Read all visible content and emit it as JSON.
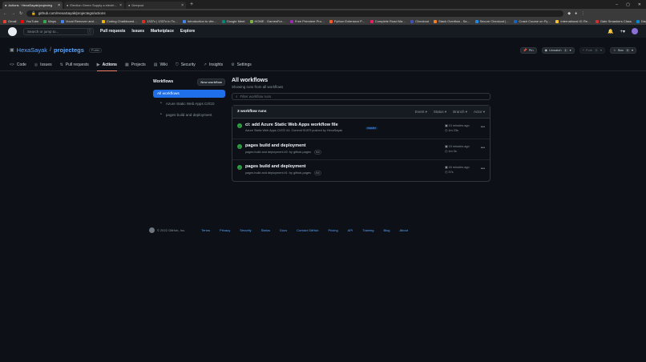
{
  "browser": {
    "tabs": [
      {
        "title": "Actions · HexaSayak/projecteg",
        "active": true
      },
      {
        "title": "Election Green Supply a electri…",
        "active": false
      },
      {
        "title": "Deepcut",
        "active": false
      }
    ],
    "url": "github.com/HexaSayak/projectegs/actions",
    "bookmarks": [
      {
        "label": "Gmail",
        "color": "#ea4335"
      },
      {
        "label": "YouTube",
        "color": "#ff0000"
      },
      {
        "label": "Maps",
        "color": "#34a853"
      },
      {
        "label": "Vocal Remover and…",
        "color": "#4285f4"
      },
      {
        "label": "Coding Chalkboard…",
        "color": "#f4b400"
      },
      {
        "label": "1337x | 1337x.to To…",
        "color": "#d93025"
      },
      {
        "label": "Introduction to vite…",
        "color": "#4285f4"
      },
      {
        "label": "Google Meet",
        "color": "#00897b"
      },
      {
        "label": "HOME - GamesFor…",
        "color": "#7cb342"
      },
      {
        "label": "Free Premiere Pro…",
        "color": "#9c27b0"
      },
      {
        "label": "Python Extension P…",
        "color": "#ff5722"
      },
      {
        "label": "Complete Road Ma…",
        "color": "#e91e63"
      },
      {
        "label": "Checkout",
        "color": "#3f51b5"
      },
      {
        "label": "Stack Overflow - Sa…",
        "color": "#f48024"
      },
      {
        "label": "Secure Checkout |…",
        "color": "#1e88e5"
      },
      {
        "label": "Crash Course on Py…",
        "color": "#1565c0"
      },
      {
        "label": "International IG Re…",
        "color": "#fbc02d"
      },
      {
        "label": "Gate Smashers Class",
        "color": "#d32f2f"
      },
      {
        "label": "Discussion Form",
        "color": "#0288d1"
      }
    ]
  },
  "github": {
    "search_placeholder": "Search or jump to...",
    "search_key": "/",
    "nav": [
      "Pull requests",
      "Issues",
      "Marketplace",
      "Explore"
    ]
  },
  "repo": {
    "owner": "HexaSayak",
    "name": "projectegs",
    "visibility": "Public",
    "pin_label": "Pin",
    "watch_label": "Unwatch",
    "watch_count": "1",
    "fork_label": "Fork",
    "fork_count": "0",
    "star_label": "Star",
    "star_count": "0",
    "tabs": [
      "Code",
      "Issues",
      "Pull requests",
      "Actions",
      "Projects",
      "Wiki",
      "Security",
      "Insights",
      "Settings"
    ]
  },
  "sidebar": {
    "title": "Workflows",
    "new_button": "New workflow",
    "all_label": "All workflows",
    "items": [
      "Azure Static Web Apps CI/CD",
      "pages build and deployment"
    ]
  },
  "content": {
    "title": "All workflows",
    "subtitle": "Showing runs from all workflows",
    "filter_placeholder": "Filter workflow runs",
    "runs_count": "3 workflow runs",
    "filters": [
      "Event",
      "Status",
      "Branch",
      "Actor"
    ],
    "runs": [
      {
        "title": "ci: add Azure Static Web Apps workflow file",
        "meta": "Azure Static Web Apps CI/CD #1: Commit 910f7f pushed by HexaSayak",
        "branch": "master",
        "bot": "",
        "time": "10 minutes ago",
        "duration": "1m 23s"
      },
      {
        "title": "pages build and deployment",
        "meta": "pages build and deployment #2: by github-pages",
        "branch": "",
        "bot": "bot",
        "time": "15 minutes ago",
        "duration": "1m 0s"
      },
      {
        "title": "pages build and deployment",
        "meta": "pages build and deployment #1: by github-pages",
        "branch": "",
        "bot": "bot",
        "time": "44 minutes ago",
        "duration": "37s"
      }
    ]
  },
  "footer": {
    "copyright": "© 2022 GitHub, Inc.",
    "links": [
      "Terms",
      "Privacy",
      "Security",
      "Status",
      "Docs",
      "Contact GitHub",
      "Pricing",
      "API",
      "Training",
      "Blog",
      "About"
    ]
  }
}
